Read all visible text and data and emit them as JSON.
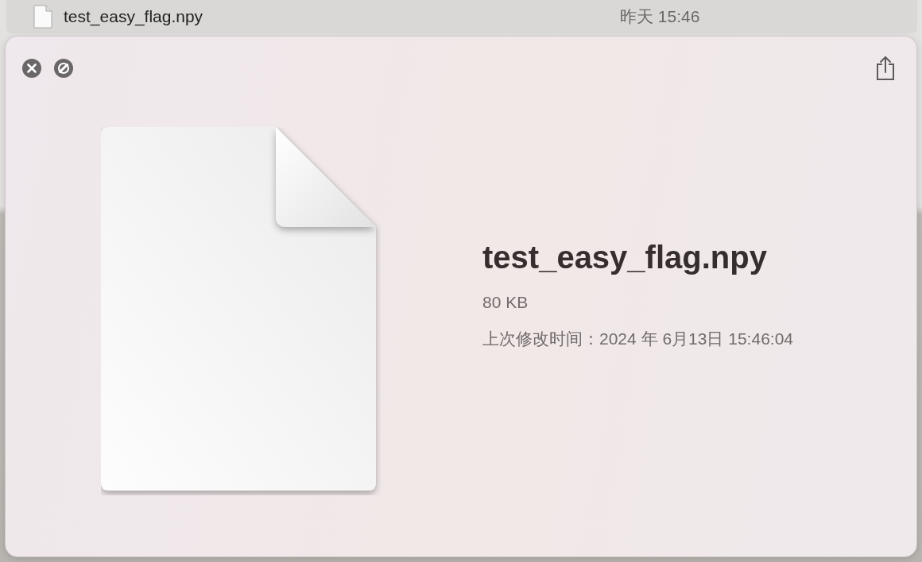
{
  "finder_row": {
    "name": "test_easy_flag.npy",
    "date": "昨天 15:46"
  },
  "preview": {
    "title": "test_easy_flag.npy",
    "size": "80 KB",
    "modified": "上次修改时间：2024 年 6月13日 15:46:04"
  }
}
